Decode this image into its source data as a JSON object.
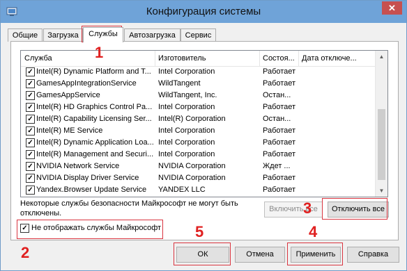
{
  "window": {
    "title": "Конфигурация системы",
    "close_label": "✕"
  },
  "tabs": [
    {
      "label": "Общие"
    },
    {
      "label": "Загрузка"
    },
    {
      "label": "Службы",
      "active": true
    },
    {
      "label": "Автозагрузка"
    },
    {
      "label": "Сервис"
    }
  ],
  "columns": {
    "service": "Служба",
    "manufacturer": "Изготовитель",
    "status": "Состоя...",
    "disabled_date": "Дата отключе..."
  },
  "services": [
    {
      "name": "Intel(R) Dynamic Platform and T...",
      "manufacturer": "Intel Corporation",
      "status": "Работает",
      "checked": true
    },
    {
      "name": "GamesAppIntegrationService",
      "manufacturer": "WildTangent",
      "status": "Работает",
      "checked": true
    },
    {
      "name": "GamesAppService",
      "manufacturer": "WildTangent, Inc.",
      "status": "Остан...",
      "checked": true
    },
    {
      "name": "Intel(R) HD Graphics Control Pa...",
      "manufacturer": "Intel Corporation",
      "status": "Работает",
      "checked": true
    },
    {
      "name": "Intel(R) Capability Licensing Ser...",
      "manufacturer": "Intel(R) Corporation",
      "status": "Остан...",
      "checked": true
    },
    {
      "name": "Intel(R) ME Service",
      "manufacturer": "Intel Corporation",
      "status": "Работает",
      "checked": true
    },
    {
      "name": "Intel(R) Dynamic Application Loa...",
      "manufacturer": "Intel Corporation",
      "status": "Работает",
      "checked": true
    },
    {
      "name": "Intel(R) Management and Securi...",
      "manufacturer": "Intel Corporation",
      "status": "Работает",
      "checked": true
    },
    {
      "name": "NVIDIA Network Service",
      "manufacturer": "NVIDIA Corporation",
      "status": "Ждет ...",
      "checked": true
    },
    {
      "name": "NVIDIA Display Driver Service",
      "manufacturer": "NVIDIA Corporation",
      "status": "Работает",
      "checked": true
    },
    {
      "name": "Yandex.Browser Update Service",
      "manufacturer": "YANDEX LLC",
      "status": "Работает",
      "checked": true
    }
  ],
  "note": "Некоторые службы безопасности Майкрософт не могут быть отключены.",
  "buttons": {
    "enable_all": "Включить все",
    "disable_all": "Отключить все",
    "ok": "ОК",
    "cancel": "Отмена",
    "apply": "Применить",
    "help": "Справка"
  },
  "hide_microsoft": {
    "label": "Не отображать службы Майкрософт",
    "checked": true
  },
  "annotations": {
    "m1": "1",
    "m2": "2",
    "m3": "3",
    "m4": "4",
    "m5": "5"
  },
  "colors": {
    "annotation": "#e02020",
    "titlebar": "#6fa3d8",
    "close": "#c75050"
  },
  "icons": {
    "app": "system-config-icon",
    "close": "close-icon",
    "scroll_up": "scroll-up-icon",
    "scroll_down": "scroll-down-icon"
  }
}
